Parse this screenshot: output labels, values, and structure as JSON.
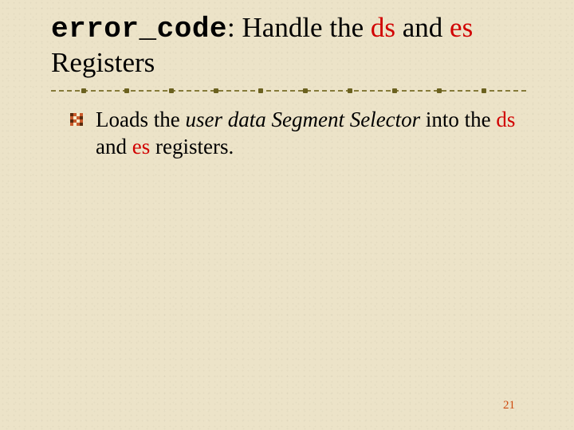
{
  "title": {
    "code_token": "error_code",
    "after_code": ": Handle the ",
    "reg1": "ds",
    "mid": " and ",
    "reg2": "es",
    "tail": "Registers"
  },
  "bullet": {
    "lead": "Loads the ",
    "italic": "user data Segment Selector",
    "after_italic": " into the ",
    "reg1": "ds",
    "mid": " and ",
    "reg2": "es",
    "tail": " registers."
  },
  "page_number": "21"
}
